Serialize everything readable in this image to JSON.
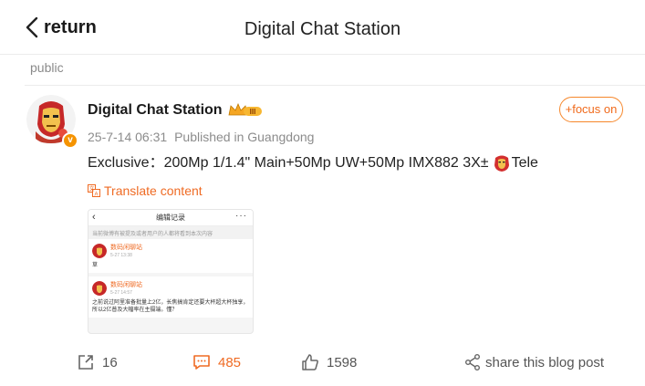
{
  "header": {
    "back_label": "return",
    "title": "Digital Chat Station"
  },
  "section_label": "public",
  "post": {
    "author": "Digital Chat Station",
    "level_badge": "III",
    "date": "25-7-14 06:31",
    "location": "Published in Guangdong",
    "follow_label": "+focus on",
    "text": "Exclusive：200Mp 1/1.4\" Main+50Mp UW+50Mp IMX882 3X±",
    "text_suffix": "Tele",
    "translate_label": "Translate content",
    "image": {
      "title": "编辑记录",
      "note": "当前微博有被提及或者用户的人都将看到本次内容",
      "cards": [
        {
          "name": "数码闲聊站",
          "time": "5-27 13:38",
          "body": "草"
        },
        {
          "name": "数码闲聊站",
          "time": "5-27 14:57",
          "body": "之前说过阿里准备批量上2亿，长焦搞肯定还要大杯超大杯独享，所以2亿普及大幅率在主摄端。懂？"
        }
      ]
    }
  },
  "actions": {
    "repost_count": "16",
    "comment_count": "485",
    "like_count": "1598",
    "share_label": "share this blog post"
  },
  "colors": {
    "accent": "#ef6b24",
    "crown": "#f5a623"
  },
  "icons": [
    "back-icon",
    "crown-icon",
    "verified-icon",
    "translate-icon",
    "repost-icon",
    "comment-icon",
    "like-icon",
    "share-icon",
    "ironman-emoji-icon"
  ]
}
